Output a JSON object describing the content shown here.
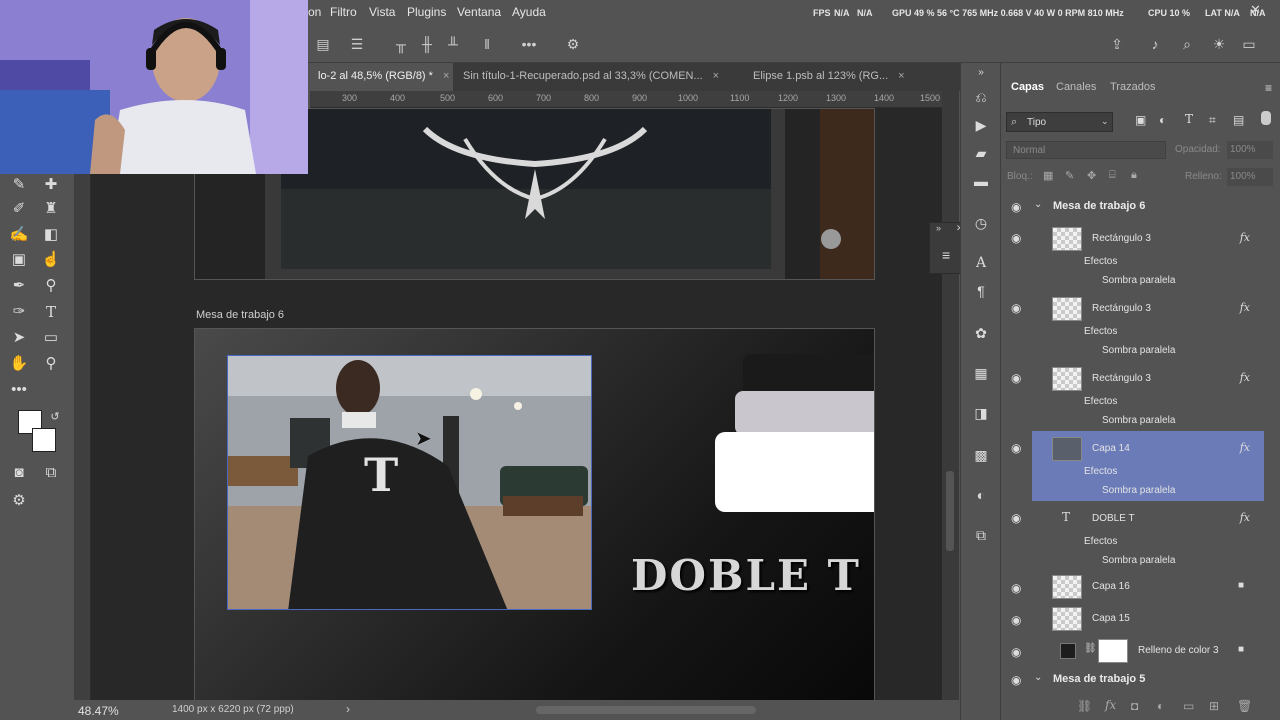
{
  "menu": {
    "items": [
      "on",
      "Filtro",
      "Vista",
      "Plugins",
      "Ventana",
      "Ayuda"
    ]
  },
  "perf": {
    "fps": "FPS",
    "fps_val": "N/A",
    "fps_val2": "N/A",
    "gpu": "GPU 49 % 56 °C 765 MHz 0.668 V 40 W 0 RPM 810 MHz",
    "cpu": "CPU 10 %",
    "lat": "LAT N/A",
    "lat2": "N/A"
  },
  "tabs": [
    {
      "label": "lo-2 al 48,5% (RGB/8) *",
      "close": "×"
    },
    {
      "label": "Sin título-1-Recuperado.psd al 33,3% (COMEN...",
      "close": "×"
    },
    {
      "label": "Elipse 1.psb al 123% (RG...",
      "close": "×"
    }
  ],
  "ruler": {
    "ticks": [
      "300",
      "400",
      "500",
      "600",
      "700",
      "800",
      "900",
      "1000",
      "1100",
      "1200",
      "1300",
      "1400",
      "1500"
    ]
  },
  "canvas": {
    "artboard_label": "Mesa de trabajo 6",
    "logo_text": "DOBLE T",
    "cape_letter": "T"
  },
  "status": {
    "zoom": "48.47%",
    "docsize": "1400 px x 6220 px (72 ppp)",
    "arrow": "›"
  },
  "panel": {
    "tabs": [
      "Capas",
      "Canales",
      "Trazados"
    ],
    "filter": "Tipo",
    "blend": "Normal",
    "opacity_label": "Opacidad:",
    "opacity_val": "100%",
    "lock_label": "Bloq.:",
    "fill_label": "Relleno:",
    "fill_val": "100%",
    "groups": [
      "Mesa de trabajo 6",
      "Mesa de trabajo 5"
    ],
    "layers": [
      {
        "name": "Rectángulo 3",
        "fx": "fx",
        "effects": "Efectos",
        "sub": "Sombra paralela"
      },
      {
        "name": "Rectángulo 3",
        "fx": "fx",
        "effects": "Efectos",
        "sub": "Sombra paralela"
      },
      {
        "name": "Rectángulo 3",
        "fx": "fx",
        "effects": "Efectos",
        "sub": "Sombra paralela"
      },
      {
        "name": "Capa 14",
        "fx": "fx",
        "effects": "Efectos",
        "sub": "Sombra paralela"
      },
      {
        "name": "DOBLE T",
        "fx": "fx",
        "effects": "Efectos",
        "sub": "Sombra paralela",
        "type_icon": "T"
      }
    ],
    "simple": [
      {
        "name": "Capa 16"
      },
      {
        "name": "Capa 15"
      },
      {
        "name": "Relleno de color 3"
      }
    ]
  },
  "colors": {
    "selected_layer": "#6a7bb8",
    "bg": "#535353",
    "canvas": "#282828"
  }
}
